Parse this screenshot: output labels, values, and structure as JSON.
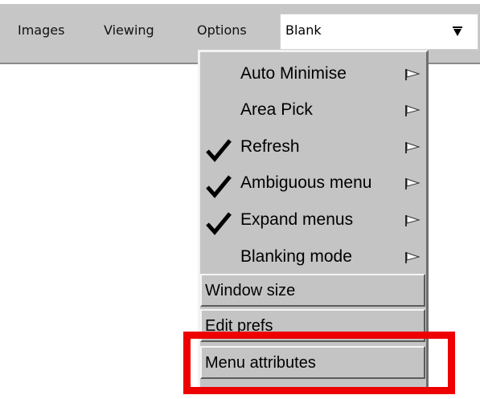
{
  "menubar": {
    "items": [
      {
        "label": "Images"
      },
      {
        "label": "Viewing"
      },
      {
        "label": "Options"
      }
    ],
    "select": {
      "value": "Blank",
      "icon": "dropdown-arrow-icon"
    }
  },
  "options_menu": {
    "items": [
      {
        "label": "Auto Minimise",
        "checked": false,
        "submenu": true
      },
      {
        "label": "Area Pick",
        "checked": false,
        "submenu": true
      },
      {
        "label": "Refresh",
        "checked": true,
        "submenu": true
      },
      {
        "label": "Ambiguous menu",
        "checked": true,
        "submenu": true
      },
      {
        "label": "Expand menus",
        "checked": true,
        "submenu": true
      },
      {
        "label": "Blanking mode",
        "checked": false,
        "submenu": true
      }
    ],
    "buttons": [
      {
        "label": "Window size"
      },
      {
        "label": "Edit prefs"
      },
      {
        "label": "Menu attributes"
      }
    ]
  },
  "colors": {
    "menu_bg": "#c4c4c4",
    "highlight": "#ee0000"
  }
}
